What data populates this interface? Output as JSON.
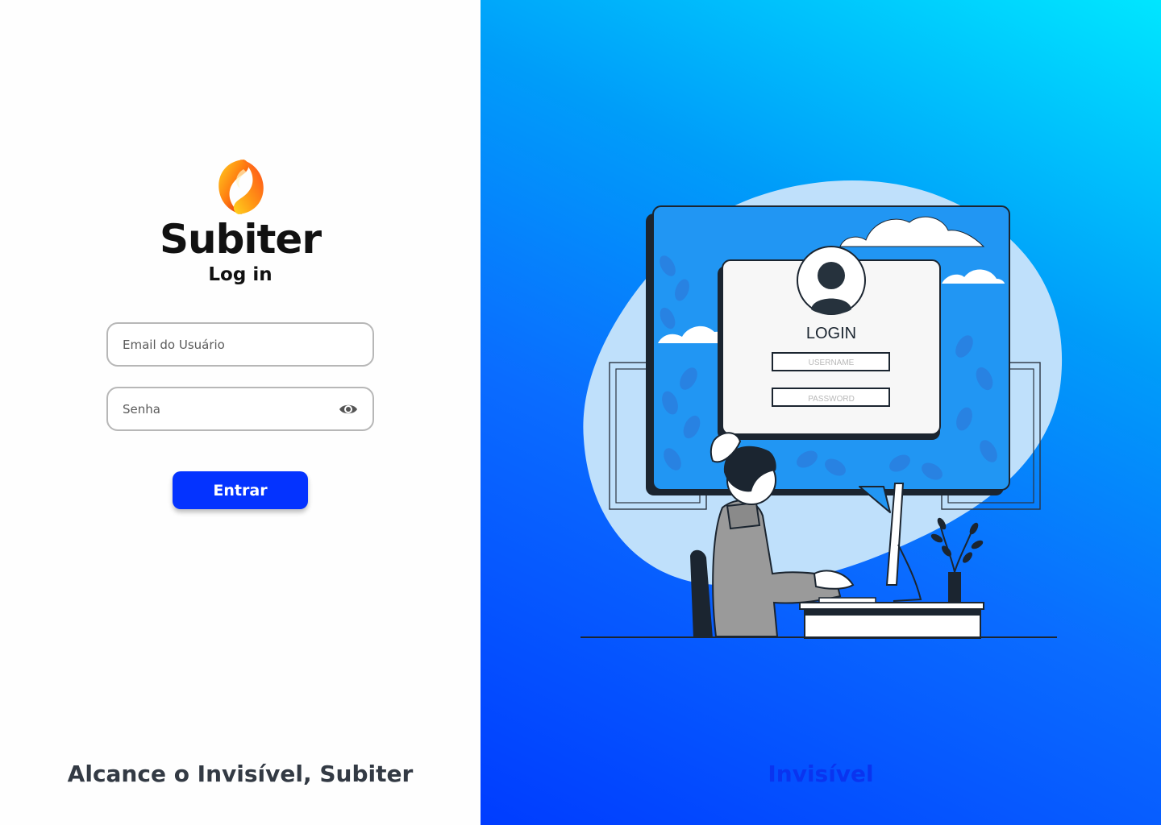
{
  "brand": {
    "name": "Subiter",
    "logo_icon": "flame-swirl-logo-icon"
  },
  "login": {
    "title": "Log in",
    "email_placeholder": "Email do Usuário",
    "password_placeholder": "Senha",
    "password_toggle_icon": "eye-icon",
    "submit_label": "Entrar"
  },
  "footer": {
    "tagline": "Alcance o Invisível, Subiter"
  },
  "hero": {
    "word": "Invisível",
    "illustration": {
      "card_title": "LOGIN",
      "username_label": "USERNAME",
      "password_label": "PASSWORD"
    }
  },
  "colors": {
    "primary_button": "#0433ff",
    "gradient_top": "#00e6ff",
    "gradient_bottom": "#003cff",
    "text_dark": "#111111",
    "field_border": "#b7b7b7"
  }
}
